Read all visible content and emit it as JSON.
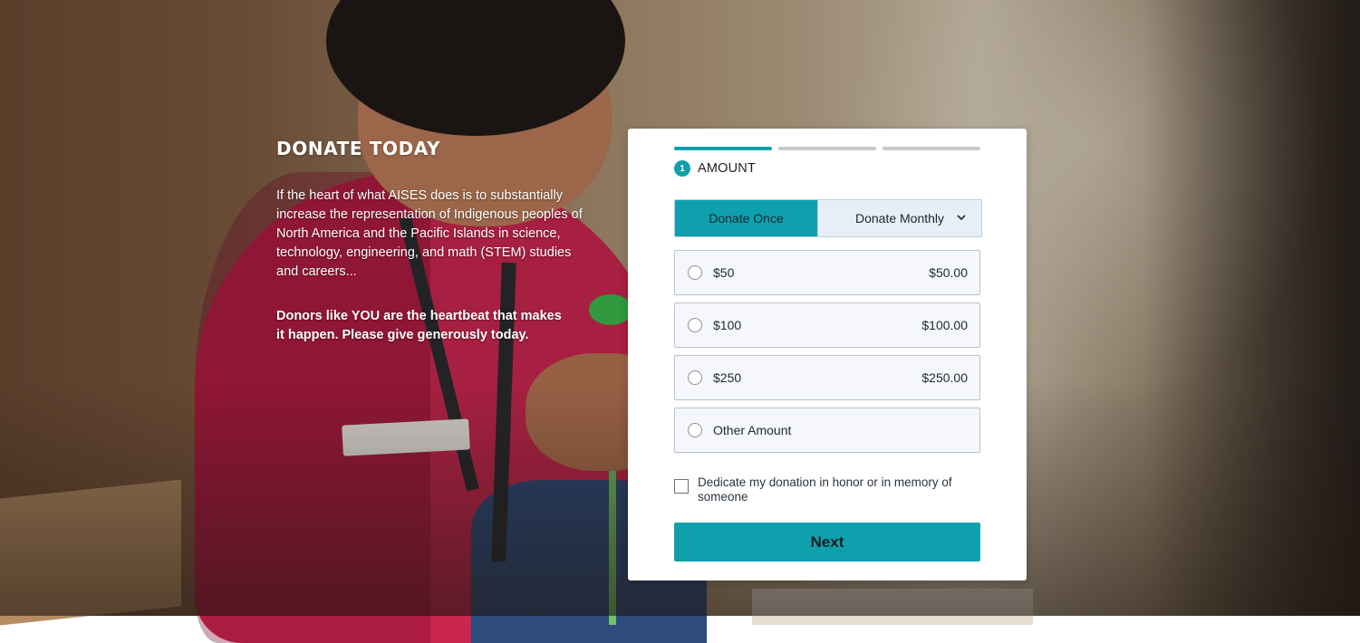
{
  "intro": {
    "title": "DONATE TODAY",
    "body": "If the heart of what AISES does is to substantially increase the representation of Indigenous peoples of North America and the Pacific Islands in science, technology, engineering, and math (STEM) studies and careers...",
    "emphasis": "Donors like YOU are the heartbeat that makes it happen. Please give generously today."
  },
  "form": {
    "step_number": "1",
    "step_label": "AMOUNT",
    "steps_total": 3,
    "current_step": 1,
    "frequency": {
      "once_label": "Donate Once",
      "monthly_label": "Donate Monthly",
      "selected": "once"
    },
    "amounts": [
      {
        "label": "$50",
        "value": "$50.00"
      },
      {
        "label": "$100",
        "value": "$100.00"
      },
      {
        "label": "$250",
        "value": "$250.00"
      },
      {
        "label": "Other Amount",
        "value": ""
      }
    ],
    "dedicate_label": "Dedicate my donation in honor or in memory of someone",
    "next_label": "Next"
  },
  "colors": {
    "accent": "#0fa0ad",
    "card_bg": "#ffffff",
    "option_bg": "#f5f7fa"
  },
  "icons": {
    "dropdown": "chevron-down-icon"
  }
}
